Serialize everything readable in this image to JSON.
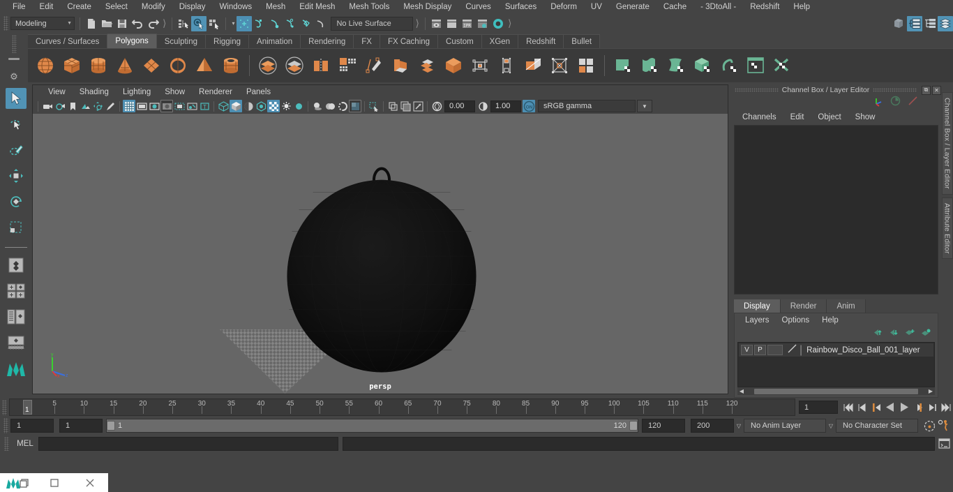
{
  "menubar": {
    "items": [
      "File",
      "Edit",
      "Create",
      "Select",
      "Modify",
      "Display",
      "Windows",
      "Mesh",
      "Edit Mesh",
      "Mesh Tools",
      "Mesh Display",
      "Curves",
      "Surfaces",
      "Deform",
      "UV",
      "Generate",
      "Cache",
      "- 3DtoAll -",
      "Redshift",
      "Help"
    ]
  },
  "statusline": {
    "menu_set": "Modeling",
    "live_surface": "No Live Surface",
    "icons": [
      "new-scene-icon",
      "open-scene-icon",
      "save-scene-icon",
      "undo-icon",
      "redo-icon",
      "select-hierarchy-icon",
      "select-object-icon",
      "select-component-icon",
      "snap-grid-icon",
      "snap-curve-icon",
      "snap-point-icon",
      "snap-view-plane-icon",
      "snap-projected-center-icon",
      "make-live-icon",
      "render-current-frame-icon",
      "ipr-render-icon",
      "render-settings-icon",
      "render-sequence-icon",
      "hypershade-icon",
      "open-outliner-icon",
      "open-node-editor-icon",
      "open-hypergraph-icon",
      "open-attribute-editor-icon",
      "lock-icon",
      "select-by-name-icon"
    ]
  },
  "shelf": {
    "tabs": [
      "Curves / Surfaces",
      "Polygons",
      "Sculpting",
      "Rigging",
      "Animation",
      "Rendering",
      "FX",
      "FX Caching",
      "Custom",
      "XGen",
      "Redshift",
      "Bullet"
    ],
    "active_tab": "Polygons",
    "buttons": [
      {
        "name": "poly-sphere-icon",
        "color": "#e0884a"
      },
      {
        "name": "poly-cube-icon",
        "color": "#e0884a"
      },
      {
        "name": "poly-cylinder-icon",
        "color": "#e0884a"
      },
      {
        "name": "poly-cone-icon",
        "color": "#e0884a"
      },
      {
        "name": "poly-plane-icon",
        "color": "#e0884a"
      },
      {
        "name": "poly-torus-icon",
        "color": "#e0884a"
      },
      {
        "name": "poly-pyramid-icon",
        "color": "#e0884a"
      },
      {
        "name": "poly-pipe-icon",
        "color": "#e0884a"
      },
      {
        "name": "boolean-union-icon",
        "color": "#e0884a"
      },
      {
        "name": "boolean-difference-icon",
        "color": "#e0884a"
      },
      {
        "name": "combine-icon",
        "color": "#e0884a"
      },
      {
        "name": "smooth-icon",
        "color": "#cfcfcf"
      },
      {
        "name": "extrude-icon",
        "color": "#cfcfcf"
      },
      {
        "name": "multi-cut-icon",
        "color": "#cfcfcf"
      },
      {
        "name": "target-weld-icon",
        "color": "#e0884a"
      },
      {
        "name": "quad-draw-icon",
        "color": "#cfcfcf"
      },
      {
        "name": "bevel-icon",
        "color": "#e0884a"
      },
      {
        "name": "bridge-icon",
        "color": "#cfcfcf"
      },
      {
        "name": "mirror-icon",
        "color": "#e0884a"
      },
      {
        "name": "center-pivot-icon",
        "color": "#cfcfcf"
      },
      {
        "name": "insert-edge-loop-icon",
        "color": "#cfcfcf"
      },
      {
        "name": "append-polygon-icon",
        "color": "#e0884a"
      },
      {
        "name": "sculpt-geometry-icon",
        "color": "#cfcfcf"
      },
      {
        "name": "transfer-attributes-icon",
        "color": "#e0884a"
      },
      {
        "name": "uv-planar-icon",
        "color": "#6ab594"
      },
      {
        "name": "uv-cylindrical-icon",
        "color": "#6ab594"
      },
      {
        "name": "uv-spherical-icon",
        "color": "#6ab594"
      },
      {
        "name": "uv-automatic-icon",
        "color": "#6ab594"
      },
      {
        "name": "uv-camera-icon",
        "color": "#6ab594"
      },
      {
        "name": "uv-editor-icon",
        "color": "#6ab594"
      },
      {
        "name": "uv-cut-sew-icon",
        "color": "#6ab594"
      }
    ]
  },
  "toolbox": {
    "tools": [
      {
        "name": "select-tool",
        "selected": true
      },
      {
        "name": "lasso-select-tool",
        "selected": false
      },
      {
        "name": "paint-select-tool",
        "selected": false
      },
      {
        "name": "move-tool",
        "selected": false
      },
      {
        "name": "rotate-tool",
        "selected": false
      },
      {
        "name": "scale-tool",
        "selected": false
      },
      {
        "name": "last-tool-used",
        "selected": false
      },
      {
        "name": "single-perspective-layout",
        "selected": false
      },
      {
        "name": "four-view-layout",
        "selected": false
      },
      {
        "name": "outliner-persp-layout",
        "selected": false
      },
      {
        "name": "persp-graph-layout",
        "selected": false
      },
      {
        "name": "maya-logo-icon",
        "selected": false
      }
    ]
  },
  "viewport": {
    "menus": [
      "View",
      "Shading",
      "Lighting",
      "Show",
      "Renderer",
      "Panels"
    ],
    "icons": [
      "select-camera-icon",
      "camera-attributes-icon",
      "bookmark-icon",
      "image-plane-icon",
      "2d-pan-zoom-icon",
      "grease-pencil-icon",
      "grid-toggle-icon",
      "film-gate-icon",
      "resolution-gate-icon",
      "gate-mask-icon",
      "film-origin-icon",
      "exposure-icon",
      "xray-joints-icon",
      "wireframe-icon",
      "smooth-shade-icon",
      "textured-icon",
      "lighting-icon",
      "shadows-icon",
      "screen-space-ao-icon",
      "motion-blur-icon",
      "multisample-icon",
      "isolate-select-icon",
      "xray-icon",
      "xray-active-icon",
      "smooth-wire-icon"
    ],
    "exposure": "0.00",
    "gamma": "1.00",
    "color_management_toggle": "ON",
    "color_profile": "sRGB gamma",
    "camera_label": "persp"
  },
  "channelbox": {
    "title": "Channel Box / Layer Editor",
    "menus": [
      "Channels",
      "Edit",
      "Object",
      "Show"
    ],
    "side_tabs": [
      "Channel Box / Layer Editor",
      "Attribute Editor"
    ],
    "header_icons": [
      "channel-box-icon",
      "anim-layer-icon",
      "expression-icon"
    ],
    "window_buttons": [
      "restore-icon",
      "close-icon"
    ]
  },
  "layer_editor": {
    "tabs": [
      "Display",
      "Render",
      "Anim"
    ],
    "active_tab": "Display",
    "menus": [
      "Layers",
      "Options",
      "Help"
    ],
    "buttons": [
      "move-layer-up-icon",
      "move-layer-down-icon",
      "new-layer-icon",
      "new-layer-from-selected-icon"
    ],
    "layers": [
      {
        "visibility": "V",
        "playback": "P",
        "color_swatch": "",
        "name": "Rainbow_Disco_Ball_001_layer"
      }
    ]
  },
  "timeslider": {
    "ticks": [
      5,
      10,
      15,
      20,
      25,
      30,
      35,
      40,
      45,
      50,
      55,
      60,
      65,
      70,
      75,
      80,
      85,
      90,
      95,
      100,
      105,
      110,
      115,
      120
    ],
    "current_frame_marker": "1",
    "current_frame_field": "1",
    "playback_buttons": [
      "go-to-start-icon",
      "step-back-keyframe-icon",
      "step-back-frame-icon",
      "play-backwards-icon",
      "play-forwards-icon",
      "step-forward-frame-icon",
      "step-forward-keyframe-icon",
      "go-to-end-icon"
    ]
  },
  "rangeslider": {
    "anim_start": "1",
    "range_start": "1",
    "bar_min_label": "1",
    "bar_max_label": "120",
    "range_end": "120",
    "anim_end": "200",
    "anim_layer": "No Anim Layer",
    "character_set": "No Character Set",
    "icons": [
      "auto-keyframe-icon",
      "animation-preferences-icon"
    ]
  },
  "commandline": {
    "language_label": "MEL",
    "input_value": "",
    "output_value": "",
    "script-editor-icon": "script-editor-icon"
  },
  "taskbar": {
    "items": [
      "maya-app-icon",
      "restore-window-icon",
      "minimize-icon",
      "close-icon"
    ]
  },
  "colors": {
    "accent_blue": "#5193b5",
    "accent_teal": "#4dbdbd",
    "accent_orange": "#e0884a",
    "accent_green": "#6ab594",
    "panel_bg": "#444444",
    "viewport_bg": "#666666",
    "field_bg": "#2b2b2b"
  }
}
